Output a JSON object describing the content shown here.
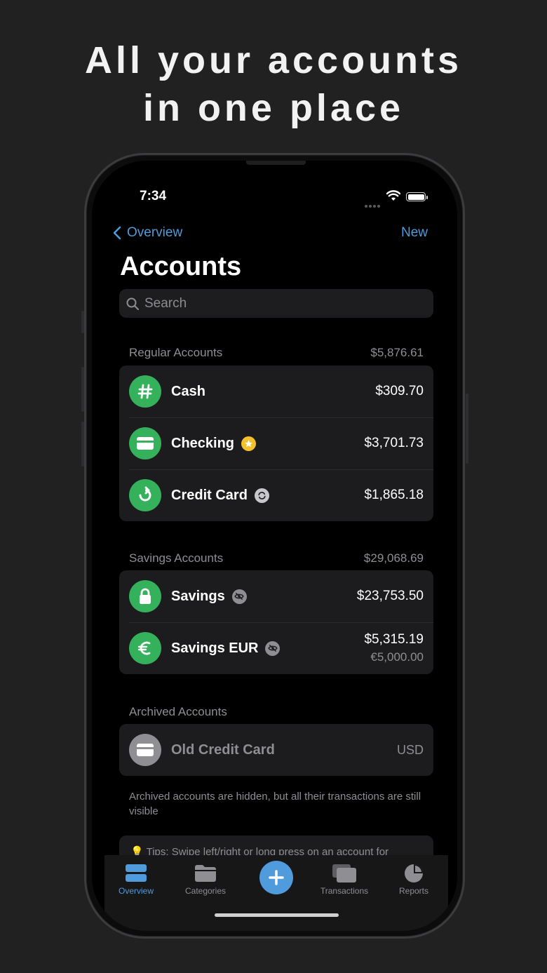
{
  "headline": {
    "line1": "All your accounts",
    "line2": "in one place"
  },
  "status": {
    "time": "7:34"
  },
  "nav": {
    "back_label": "Overview",
    "new_label": "New"
  },
  "page": {
    "title": "Accounts"
  },
  "search": {
    "placeholder": "Search"
  },
  "regular": {
    "header": "Regular Accounts",
    "total": "$5,876.61",
    "items": [
      {
        "name": "Cash",
        "amount": "$309.70",
        "icon": "hash-icon"
      },
      {
        "name": "Checking",
        "amount": "$3,701.73",
        "icon": "card-icon",
        "badge": "star-icon"
      },
      {
        "name": "Credit Card",
        "amount": "$1,865.18",
        "icon": "cycle-icon",
        "badge": "cycle-icon"
      }
    ]
  },
  "savings": {
    "header": "Savings Accounts",
    "total": "$29,068.69",
    "items": [
      {
        "name": "Savings",
        "amount": "$23,753.50",
        "icon": "lock-icon",
        "badge": "eye-slash-icon"
      },
      {
        "name": "Savings EUR",
        "amount": "$5,315.19",
        "sub_amount": "€5,000.00",
        "icon": "euro-icon",
        "badge": "eye-slash-icon"
      }
    ]
  },
  "archived": {
    "header": "Archived Accounts",
    "items": [
      {
        "name": "Old Credit Card",
        "amount": "USD",
        "icon": "card-icon"
      }
    ],
    "footnote": "Archived accounts are hidden, but all their transactions are still visible"
  },
  "tips": {
    "text": "Tips: Swipe left/right or long press on an account for"
  },
  "tabs": [
    {
      "label": "Overview",
      "icon": "overview-icon",
      "active": true
    },
    {
      "label": "Categories",
      "icon": "folder-icon"
    },
    {
      "label": "",
      "icon": "plus-icon"
    },
    {
      "label": "Transactions",
      "icon": "transactions-icon"
    },
    {
      "label": "Reports",
      "icon": "pie-chart-icon"
    }
  ],
  "colors": {
    "accent": "#4f9bdb",
    "green": "#34b15a",
    "star": "#f3c12b",
    "background": "#212122"
  }
}
